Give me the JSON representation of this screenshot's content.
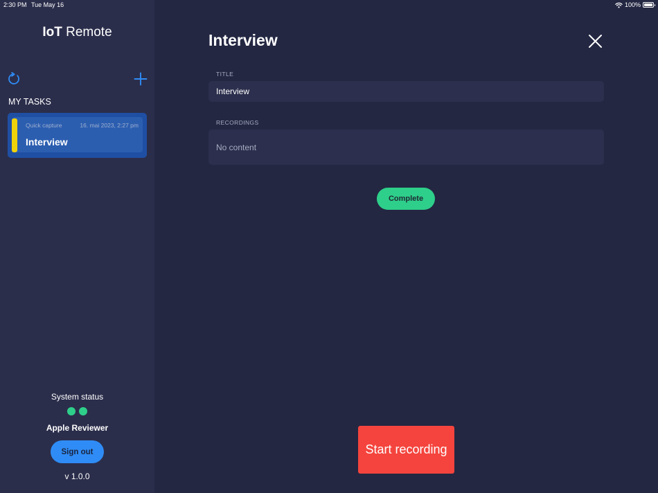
{
  "status_bar": {
    "time": "2:30 PM",
    "date": "Tue May 16",
    "battery": "100%",
    "battery_level": 1.0
  },
  "sidebar": {
    "app_title_bold": "IoT",
    "app_title_rest": " Remote",
    "icons": [
      "refresh-icon",
      "plus-icon"
    ],
    "tasks_heading": "MY TASKS",
    "tasks": [
      {
        "type": "Quick capture",
        "date": "16. mai 2023, 2:27 pm",
        "title": "Interview"
      }
    ],
    "system_status_label": "System status",
    "user_name": "Apple Reviewer",
    "signout_label": "Sign out",
    "version": "v 1.0.0"
  },
  "detail": {
    "title": "Interview",
    "title_field_label": "TITLE",
    "title_field_value": "Interview",
    "recordings_label": "RECORDINGS",
    "recordings_empty": "No content",
    "complete_label": "Complete",
    "record_label": "Start recording"
  },
  "colors": {
    "background": "#232742",
    "sidebar": "#2b2e4b",
    "accent_blue": "#2f8cf6",
    "task_card": "#1f4fa3",
    "task_stripe": "#f0d20a",
    "status_green": "#2ecf8a",
    "record_red": "#f4443d"
  }
}
